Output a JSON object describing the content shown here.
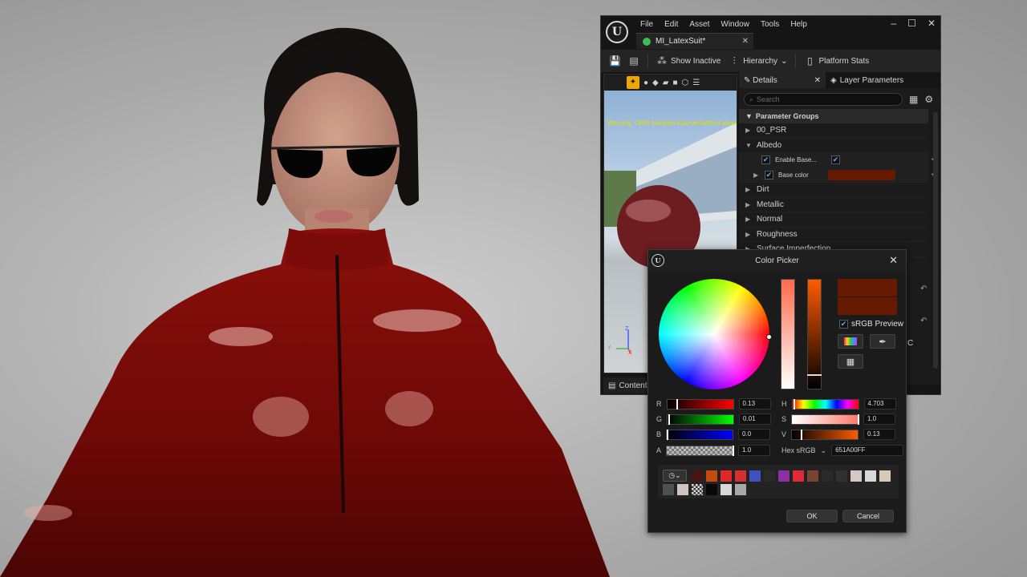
{
  "editor": {
    "menu": [
      "File",
      "Edit",
      "Asset",
      "Window",
      "Tools",
      "Help"
    ],
    "logo": "U",
    "window_buttons": {
      "minimize": "–",
      "maximize": "☐",
      "close": "✕"
    },
    "tab_title": "MI_LatexSuit*",
    "toolbar": {
      "show_inactive": "Show Inactive",
      "hierarchy": "Hierarchy",
      "platform_stats": "Platform Stats"
    },
    "preview": {
      "warning": "Warning: ORM samples /Game/Outfits/Latexsu",
      "axis": {
        "x": "X",
        "y": "Y",
        "z": "Z"
      }
    },
    "content_drawer": "Content D",
    "details": {
      "tab_details": "Details",
      "tab_layers": "Layer Parameters",
      "search_placeholder": "Search",
      "group_header": "Parameter Groups",
      "groups": [
        "00_PSR",
        "Albedo",
        "Dirt",
        "Metallic",
        "Normal",
        "Roughness"
      ],
      "albedo_params": [
        {
          "label": "Enable Base..."
        },
        {
          "label": "Base color",
          "color": "#651a00"
        }
      ],
      "partial_row": "Surface Imperfection",
      "partial_label_c": "C"
    }
  },
  "color_picker": {
    "title": "Color Picker",
    "current_color": "#651A00",
    "srgb_preview": "sRGB Preview",
    "rgba": [
      {
        "label": "R",
        "value": "0.13",
        "fraction": 0.13
      },
      {
        "label": "G",
        "value": "0.01",
        "fraction": 0.01
      },
      {
        "label": "B",
        "value": "0.0",
        "fraction": 0.0
      },
      {
        "label": "A",
        "value": "1.0",
        "fraction": 1.0
      }
    ],
    "hsv": [
      {
        "label": "H",
        "value": "4.703",
        "fraction": 0.013
      },
      {
        "label": "S",
        "value": "1.0",
        "fraction": 1.0
      },
      {
        "label": "V",
        "value": "0.13",
        "fraction": 0.13
      }
    ],
    "hex_label": "Hex sRGB",
    "hex_value": "651A00FF",
    "swatch_colors_row1": [
      "#4a1410",
      "#c44a10",
      "#e02828",
      "#d43030",
      "#4050c0",
      "#2a2a2a",
      "#8a30a0",
      "#e02a3a",
      "#7a4530",
      "#2a2a2a",
      "#303030",
      "#d8c8c4",
      "#d8d8d8",
      "#d8c8b8"
    ],
    "swatch_colors_row2": [
      "#505050",
      "#d0c4c0",
      "#checker",
      "#080808",
      "#d8d8d8",
      "#a8a8a8"
    ],
    "ok": "OK",
    "cancel": "Cancel"
  }
}
